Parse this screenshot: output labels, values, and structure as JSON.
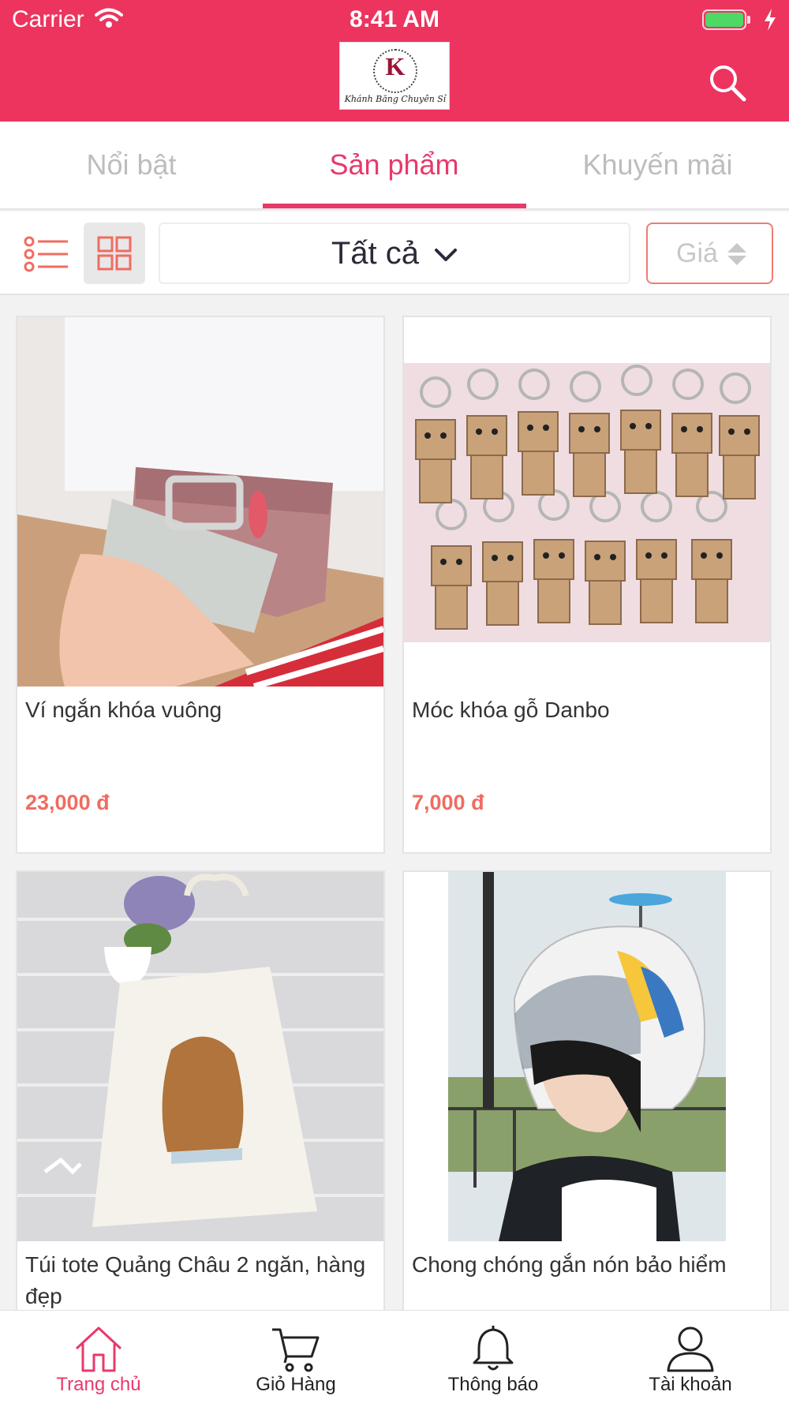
{
  "status_bar": {
    "carrier": "Carrier",
    "time": "8:41 AM"
  },
  "header": {
    "logo_letter": "K",
    "logo_text": "Khánh Băng Chuyên Sỉ",
    "search_icon": "search-icon",
    "colors": {
      "brand": "#ec345f",
      "accent": "#e8396a",
      "price": "#f06c61"
    }
  },
  "tabs": [
    {
      "label": "Nổi bật",
      "active": false
    },
    {
      "label": "Sản phẩm",
      "active": true
    },
    {
      "label": "Khuyến mãi",
      "active": false
    }
  ],
  "toolbar": {
    "list_view_icon": "list-view-icon",
    "grid_view_icon": "grid-view-icon",
    "selected_view": "grid",
    "category_filter": "Tất cả",
    "price_sort_label": "Giá"
  },
  "products": [
    {
      "name": "Ví ngắn khóa vuông",
      "price": "23,000 đ",
      "image": "pink wallet held in hand"
    },
    {
      "name": "Móc khóa gỗ Danbo",
      "price": "7,000 đ",
      "image": "wooden Danbo keychains"
    },
    {
      "name": "Túi tote Quảng Châu 2 ngăn, hàng đẹp",
      "price": "",
      "image": "canvas tote bag with girl print"
    },
    {
      "name": "Chong chóng gắn nón bảo hiểm",
      "price": "",
      "image": "helmet with propeller"
    }
  ],
  "bottom_nav": [
    {
      "label": "Trang chủ",
      "icon": "home-icon",
      "active": true
    },
    {
      "label": "Giỏ Hàng",
      "icon": "cart-icon",
      "active": false
    },
    {
      "label": "Thông báo",
      "icon": "bell-icon",
      "active": false
    },
    {
      "label": "Tài khoản",
      "icon": "user-icon",
      "active": false
    }
  ]
}
